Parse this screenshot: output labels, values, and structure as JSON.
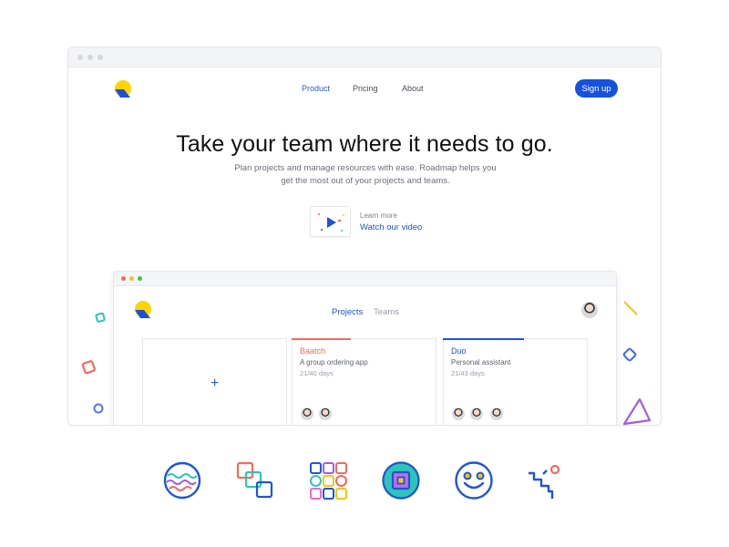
{
  "nav": {
    "links": [
      {
        "label": "Product",
        "active": true
      },
      {
        "label": "Pricing",
        "active": false
      },
      {
        "label": "About",
        "active": false
      }
    ],
    "signup_label": "Sign up"
  },
  "hero": {
    "title": "Take your team where it needs to go.",
    "subtitle_line1": "Plan projects and manage resources with ease. Roadmap helps you",
    "subtitle_line2": "get the most out of your projects and teams.",
    "learn_more": "Learn more",
    "watch_video": "Watch our video"
  },
  "app": {
    "tabs": [
      {
        "label": "Projects",
        "active": true
      },
      {
        "label": "Teams",
        "active": false
      }
    ],
    "add_symbol": "+",
    "projects": [
      {
        "name": "Baatch",
        "description": "A group ordering app",
        "days": "21/40 days",
        "progress": 0.525,
        "color": "#f26b5b",
        "members": 2
      },
      {
        "name": "Duo",
        "description": "Personal assistant",
        "days": "21/43 days",
        "progress": 0.488,
        "color": "#1e55d8",
        "members": 3
      }
    ]
  },
  "colors": {
    "accent": "#1652e0",
    "logo_yellow": "#ffd400",
    "logo_blue": "#1f4fd6",
    "coral": "#f26b5b"
  },
  "icons": [
    "globe-waves-icon",
    "overlapping-squares-icon",
    "shape-grid-icon",
    "framed-square-icon",
    "smiley-face-icon",
    "squiggle-path-icon"
  ]
}
